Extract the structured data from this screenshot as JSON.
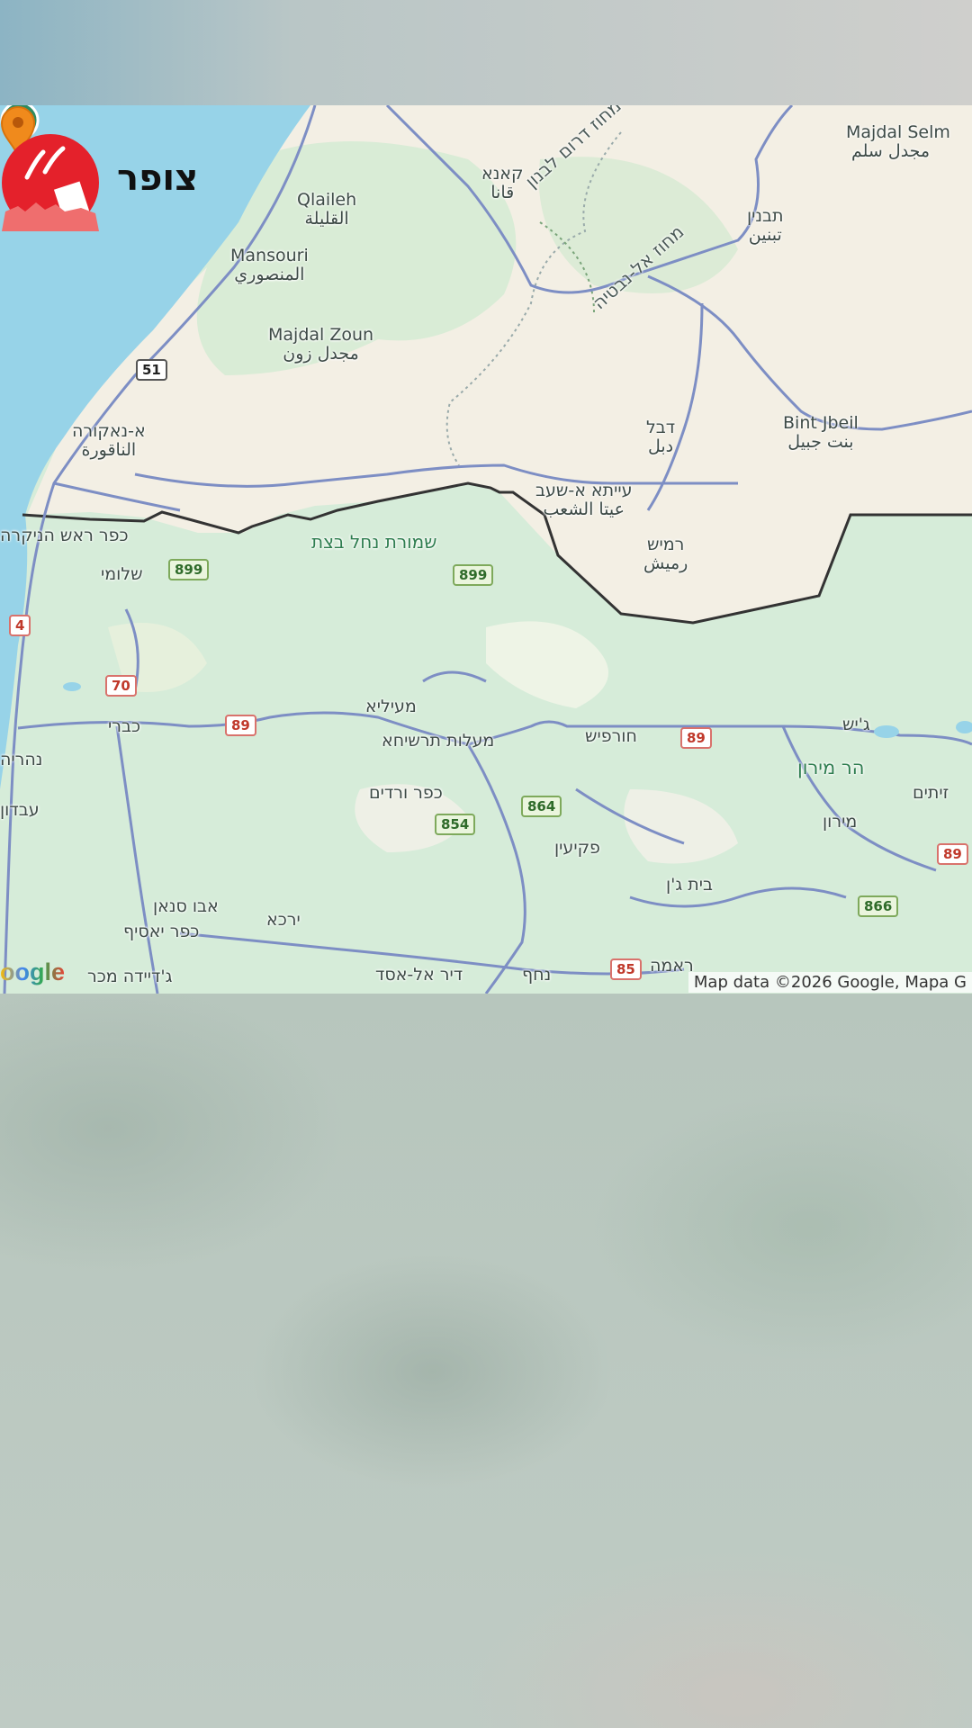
{
  "brand": {
    "name": "צופר"
  },
  "map": {
    "places": [
      {
        "id": "majdal-selm",
        "lines": [
          "Majdal Selm",
          "مجدل سلم"
        ]
      },
      {
        "id": "qana",
        "lines": [
          "קאנא",
          "قانا"
        ]
      },
      {
        "id": "qlaileh",
        "lines": [
          "Qlaileh",
          "القليلة"
        ]
      },
      {
        "id": "mansouri",
        "lines": [
          "Mansouri",
          "المنصوري"
        ]
      },
      {
        "id": "majdal-zoun",
        "lines": [
          "Majdal Zoun",
          "مجدل زون"
        ]
      },
      {
        "id": "tebnine",
        "lines": [
          "תבנין",
          "تبنين"
        ]
      },
      {
        "id": "naqoura",
        "lines": [
          "א-נאקורה",
          "الناقورة"
        ]
      },
      {
        "id": "debel",
        "lines": [
          "דבל",
          "دبل"
        ]
      },
      {
        "id": "bint-jbeil",
        "lines": [
          "Bint Jbeil",
          "بنت جبيل"
        ]
      },
      {
        "id": "aitaa",
        "lines": [
          "עייתא א-שעב",
          "عيتا الشعب"
        ]
      },
      {
        "id": "rmeish",
        "lines": [
          "רמיש",
          "رميش"
        ]
      },
      {
        "id": "rosh-hanikra",
        "lines": [
          "כפר ראש הניקרה"
        ]
      },
      {
        "id": "shlomi",
        "lines": [
          "שלומי"
        ]
      },
      {
        "id": "kabri",
        "lines": [
          "כברי"
        ]
      },
      {
        "id": "nahariya",
        "lines": [
          "נהריה"
        ]
      },
      {
        "id": "miilya",
        "lines": [
          "מעיליא"
        ]
      },
      {
        "id": "maalot",
        "lines": [
          "מעלות תרשיחא"
        ]
      },
      {
        "id": "hurfeish",
        "lines": [
          "חורפיש"
        ]
      },
      {
        "id": "jish",
        "lines": [
          "ג'יש"
        ]
      },
      {
        "id": "kfar-vradim",
        "lines": [
          "כפר ורדים"
        ]
      },
      {
        "id": "peqiin",
        "lines": [
          "פקיעין"
        ]
      },
      {
        "id": "meron",
        "lines": [
          "מירון"
        ]
      },
      {
        "id": "beit-jann",
        "lines": [
          "בית ג'ן"
        ]
      },
      {
        "id": "avdon",
        "lines": [
          "עבדון"
        ]
      },
      {
        "id": "abu-snan",
        "lines": [
          "אבו סנאן"
        ]
      },
      {
        "id": "kfar-yasif",
        "lines": [
          "כפר יאסיף"
        ]
      },
      {
        "id": "yarka",
        "lines": [
          "ירכא"
        ]
      },
      {
        "id": "jadeidi",
        "lines": [
          "ג'דיידה מכר"
        ]
      },
      {
        "id": "deir-al-asad",
        "lines": [
          "דיר אל-אסד"
        ]
      },
      {
        "id": "nahf",
        "lines": [
          "נחף"
        ]
      },
      {
        "id": "rame",
        "lines": [
          "ראמה"
        ]
      },
      {
        "id": "zeitim",
        "lines": [
          "זיתים"
        ]
      }
    ],
    "regions": [
      {
        "id": "south-lebanon",
        "text": "מחוז דרום לבנון"
      },
      {
        "id": "nabatieh",
        "text": "מחוז אל-נבטיה"
      }
    ],
    "park_label": "שמורת נחל בצת",
    "peak_label": "הר מירון",
    "roads": [
      {
        "id": "r51",
        "num": "51",
        "style": "white"
      },
      {
        "id": "r899a",
        "num": "899",
        "style": "green"
      },
      {
        "id": "r899b",
        "num": "899",
        "style": "green"
      },
      {
        "id": "r4",
        "num": "4",
        "style": "red"
      },
      {
        "id": "r70",
        "num": "70",
        "style": "red"
      },
      {
        "id": "r89a",
        "num": "89",
        "style": "red"
      },
      {
        "id": "r89b",
        "num": "89",
        "style": "red"
      },
      {
        "id": "r89c",
        "num": "89",
        "style": "red"
      },
      {
        "id": "r854",
        "num": "854",
        "style": "green"
      },
      {
        "id": "r864",
        "num": "864",
        "style": "green"
      },
      {
        "id": "r866",
        "num": "866",
        "style": "green"
      },
      {
        "id": "r85",
        "num": "85",
        "style": "red"
      }
    ],
    "google_logo": "oogle",
    "attribution": "Map data ©2026 Google, Mapa G"
  }
}
